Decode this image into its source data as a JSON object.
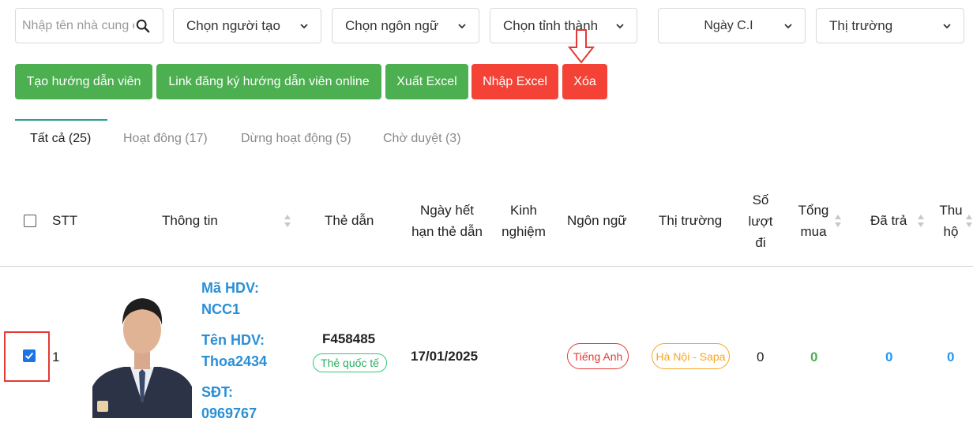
{
  "filters": {
    "search_placeholder": "Nhập tên nhà cung cấp",
    "creator": "Chọn người tạo",
    "language": "Chọn ngôn ngữ",
    "province": "Chọn tỉnh thành",
    "date": "Ngày C.I",
    "market": "Thị trường"
  },
  "buttons": {
    "create_guide": "Tạo hướng dẫn viên",
    "register_link": "Link đăng ký hướng dẫn viên online",
    "export_excel": "Xuất Excel",
    "import_excel": "Nhập Excel",
    "delete": "Xóa"
  },
  "tabs": [
    {
      "label": "Tất cả (25)"
    },
    {
      "label": "Hoạt đông (17)"
    },
    {
      "label": "Dừng hoạt động (5)"
    },
    {
      "label": "Chờ duyệt (3)"
    }
  ],
  "table": {
    "headers": {
      "stt": "STT",
      "info": "Thông tin",
      "card": "Thẻ dẫn",
      "expiry_1": "Ngày hết",
      "expiry_2": "hạn thẻ dẫn",
      "exp_1": "Kinh",
      "exp_2": "nghiệm",
      "language": "Ngôn ngữ",
      "market": "Thị trường",
      "trips_1": "Số",
      "trips_2": "lượt",
      "trips_3": "đi",
      "total_1": "Tổng",
      "total_2": "mua",
      "paid": "Đã trả",
      "collect_1": "Thu",
      "collect_2": "hộ"
    },
    "rows": [
      {
        "stt": "1",
        "checked": true,
        "code_label": "Mã HDV:",
        "code": "NCC1",
        "name_label": "Tên HDV:",
        "name": "Thoa2434",
        "phone_label": "SĐT:",
        "phone": "0969767",
        "card_number": "F458485",
        "card_type": "Thẻ quốc tế",
        "expiry": "17/01/2025",
        "language": "Tiếng Anh",
        "market": "Hà Nội - Sapa",
        "trips": "0",
        "total": "0",
        "paid": "0",
        "collect": "0"
      }
    ]
  },
  "colors": {
    "green": "#4caf50",
    "red": "#f44336",
    "link_blue": "#2b8fd6",
    "teal_tab": "#2a9d8f"
  }
}
